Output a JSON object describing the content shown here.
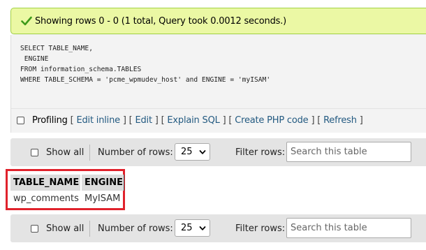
{
  "success": {
    "message": "Showing rows 0 - 0 (1 total, Query took 0.0012 seconds.)",
    "icon": "check-icon",
    "color": "#ebf8a4"
  },
  "sql": {
    "lines": [
      "SELECT TABLE_NAME,",
      " ENGINE",
      "FROM information_schema.TABLES",
      "WHERE TABLE_SCHEMA = 'pcme_wpmudev_host' and ENGINE = 'myISAM'"
    ]
  },
  "profiling": {
    "label": "Profiling",
    "links": [
      "Edit inline",
      "Edit",
      "Explain SQL",
      "Create PHP code",
      "Refresh"
    ]
  },
  "nav_top": {
    "show_all": "Show all",
    "number_of_rows_label": "Number of rows:",
    "rows_value": "25",
    "filter_label": "Filter rows:",
    "search_placeholder": "Search this table"
  },
  "nav_bottom": {
    "show_all": "Show all",
    "number_of_rows_label": "Number of rows:",
    "rows_value": "25",
    "filter_label": "Filter rows:",
    "search_placeholder": "Search this table"
  },
  "results": {
    "columns": [
      "TABLE_NAME",
      "ENGINE"
    ],
    "rows": [
      [
        "wp_comments",
        "MyISAM"
      ]
    ]
  },
  "colors": {
    "highlight_border": "#e0222c",
    "link": "#235a81"
  }
}
